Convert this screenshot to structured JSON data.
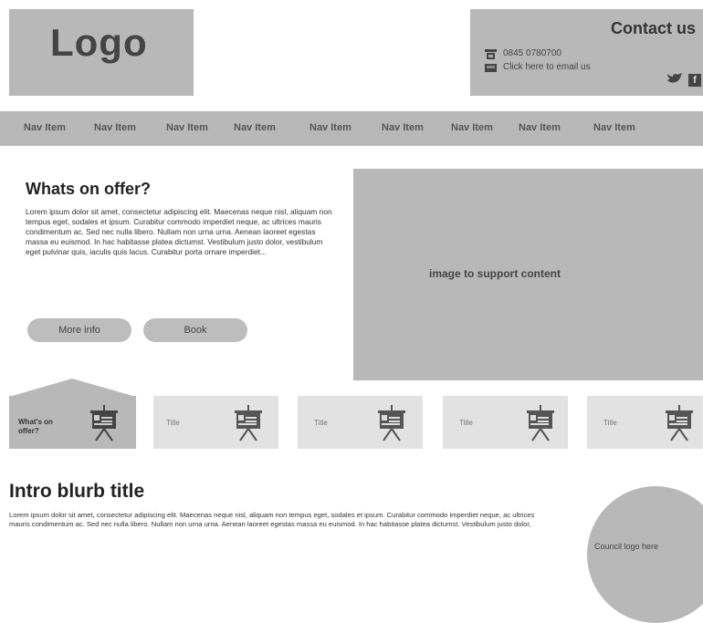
{
  "header": {
    "logo": "Logo",
    "contact": {
      "title": "Contact us",
      "phone": "0845 0780700",
      "email_link": "Click here to email us",
      "icons": [
        "phone-icon",
        "email-icon",
        "twitter-icon",
        "facebook-icon"
      ]
    }
  },
  "nav": {
    "items": [
      "Nav Item",
      "Nav Item",
      "Nav Item",
      "Nav Item",
      "Nav Item",
      "Nav Item",
      "Nav Item",
      "Nav Item",
      "Nav Item"
    ]
  },
  "offer": {
    "title": "Whats on offer?",
    "body": "Lorem ipsum dolor sit amet, consectetur adipiscing elit. Maecenas neque nisl, aliquam non tempus eget, sodales et ipsum. Curabitur commodo imperdiet neque, ac ultrices mauris condimentum ac. Sed nec nulla libero. Nullam non urna urna. Aenean laoreet egestas massa eu euismod. In hac habitasse platea dictumst. Vestibulum justo dolor, vestibulum eget pulvinar quis, iaculis quis lacus. Curabitur porta ornare imperdiet...",
    "buttons": [
      "More info",
      "Book"
    ],
    "image_label": "image to support content"
  },
  "tiles": [
    {
      "label": "What's on offer?",
      "active": true
    },
    {
      "label": "Title",
      "active": false
    },
    {
      "label": "Title",
      "active": false
    },
    {
      "label": "Title",
      "active": false
    },
    {
      "label": "Title",
      "active": false
    }
  ],
  "intro": {
    "title": "Intro blurb title",
    "body": "Lorem ipsum dolor sit amet, consectetur adipiscing elit. Maecenas neque nisl, aliquam non tempus eget, sodales et ipsum. Curabitur commodo imperdiet neque, ac ultrices mauris condimentum ac. Sed nec nulla libero. Nullam non urna urna. Aenean laoreet egestas massa eu euismod. In hac habitasse platea dictumst. Vestibulum justo dolor,",
    "council_logo": "Council logo here"
  },
  "colors": {
    "block_grey": "#b8b8b8",
    "tile_light": "#e2e2e2",
    "text_dark": "#222222"
  }
}
